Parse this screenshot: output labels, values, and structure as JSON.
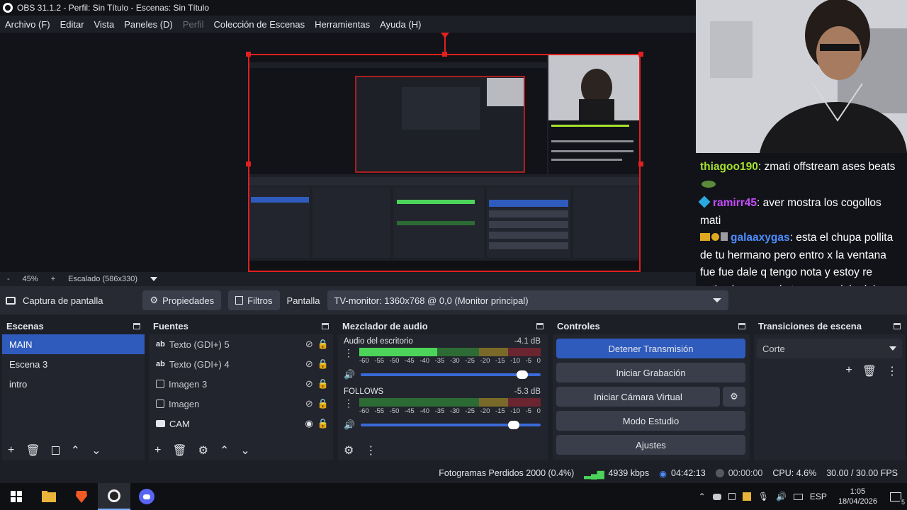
{
  "window": {
    "title": "OBS 31.1.2 - Perfil: Sin Título - Escenas: Sin Título"
  },
  "menu": [
    "Archivo (F)",
    "Editar",
    "Vista",
    "Paneles (D)",
    "Perfil",
    "Colección de Escenas",
    "Herramientas",
    "Ayuda (H)"
  ],
  "chat": {
    "messages": [
      {
        "user": "thiagoo190",
        "user_color": "#a6e22e",
        "text": ": zmati offstream ases beats"
      },
      {
        "user": "ramirr45",
        "user_color": "#c74cff",
        "text": ": aver mostra los cogollos mati"
      },
      {
        "user": "galaaxygas",
        "user_color": "#4c8dff",
        "text": ": esta el chupa pollita de tu hermano pero entro x la ventana fue fue dale q tengo nota y estoy re activo la conca de tu mama dale dale dale dalee"
      }
    ]
  },
  "zoom": {
    "minus": "-",
    "value": "45%",
    "plus": "+",
    "scale": "Escalado (586x330)"
  },
  "source_toolbar": {
    "source_name": "Captura de pantalla",
    "properties": "Propiedades",
    "filters": "Filtros",
    "display_label": "Pantalla",
    "display_value": "TV-monitor: 1360x768 @ 0,0 (Monitor principal)"
  },
  "scenes": {
    "title": "Escenas",
    "items": [
      "MAIN",
      "Escena 3",
      "intro"
    ],
    "selected": 0
  },
  "sources": {
    "title": "Fuentes",
    "items": [
      {
        "icon": "text-icon",
        "label": "Texto (GDI+) 5",
        "visible": false
      },
      {
        "icon": "text-icon",
        "label": "Texto (GDI+) 4",
        "visible": false
      },
      {
        "icon": "image-icon",
        "label": "Imagen 3",
        "visible": false
      },
      {
        "icon": "image-icon",
        "label": "Imagen",
        "visible": false
      },
      {
        "icon": "camera-icon",
        "label": "CAM",
        "visible": true
      }
    ]
  },
  "mixer": {
    "title": "Mezclador de audio",
    "channels": [
      {
        "name": "Audio del escritorio",
        "db": "-4.1 dB",
        "level": 0.43,
        "volume": 0.93
      },
      {
        "name": "FOLLOWS",
        "db": "-5.3 dB",
        "level": 0.0,
        "volume": 0.88
      }
    ],
    "ticks": [
      "-60",
      "-55",
      "-50",
      "-45",
      "-40",
      "-35",
      "-30",
      "-25",
      "-20",
      "-15",
      "-10",
      "-5",
      "0"
    ]
  },
  "controls": {
    "title": "Controles",
    "stop_stream": "Detener Transmisión",
    "start_record": "Iniciar Grabación",
    "start_virtual_cam": "Iniciar Cámara Virtual",
    "studio_mode": "Modo Estudio",
    "settings": "Ajustes"
  },
  "transitions": {
    "title": "Transiciones de escena",
    "selected": "Corte"
  },
  "status": {
    "dropped_frames": "Fotogramas Perdidos 2000 (0.4%)",
    "bitrate": "4939 kbps",
    "stream_time": "04:42:13",
    "record_time": "00:00:00",
    "cpu": "CPU: 4.6%",
    "fps": "30.00 / 30.00 FPS"
  },
  "taskbar": {
    "lang": "ESP",
    "time": "1:05",
    "date": "18/04/2026",
    "notifications": "5"
  },
  "colors": {
    "accent": "#2f5bbd",
    "bg": "#1c1f26",
    "dock": "#22252d",
    "source_outline": "#e02020"
  }
}
